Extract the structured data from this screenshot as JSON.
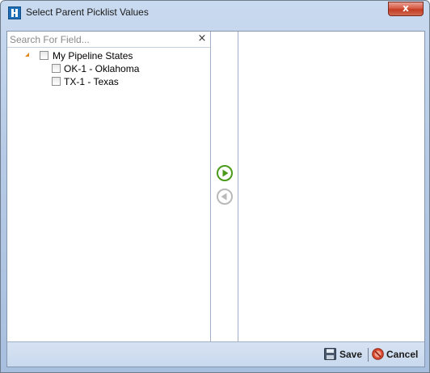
{
  "window": {
    "title": "Select Parent Picklist Values",
    "close_label": "x"
  },
  "search": {
    "placeholder": "Search For Field...",
    "value": "",
    "clear_label": "×"
  },
  "tree": {
    "root": {
      "label": "My Pipeline States",
      "expanded": true,
      "checked": false
    },
    "children": [
      {
        "label": "OK-1 - Oklahoma",
        "checked": false
      },
      {
        "label": "TX-1 - Texas",
        "checked": false
      }
    ]
  },
  "transfer": {
    "add_icon": "arrow-right-circle-icon",
    "remove_icon": "arrow-left-circle-icon",
    "add_enabled": true,
    "remove_enabled": false
  },
  "footer": {
    "save_label": "Save",
    "cancel_label": "Cancel"
  },
  "colors": {
    "accent_green": "#4a9a1c",
    "disabled_gray": "#b9b9b9",
    "expander_orange": "#e08a1e",
    "close_red": "#c23b22"
  }
}
